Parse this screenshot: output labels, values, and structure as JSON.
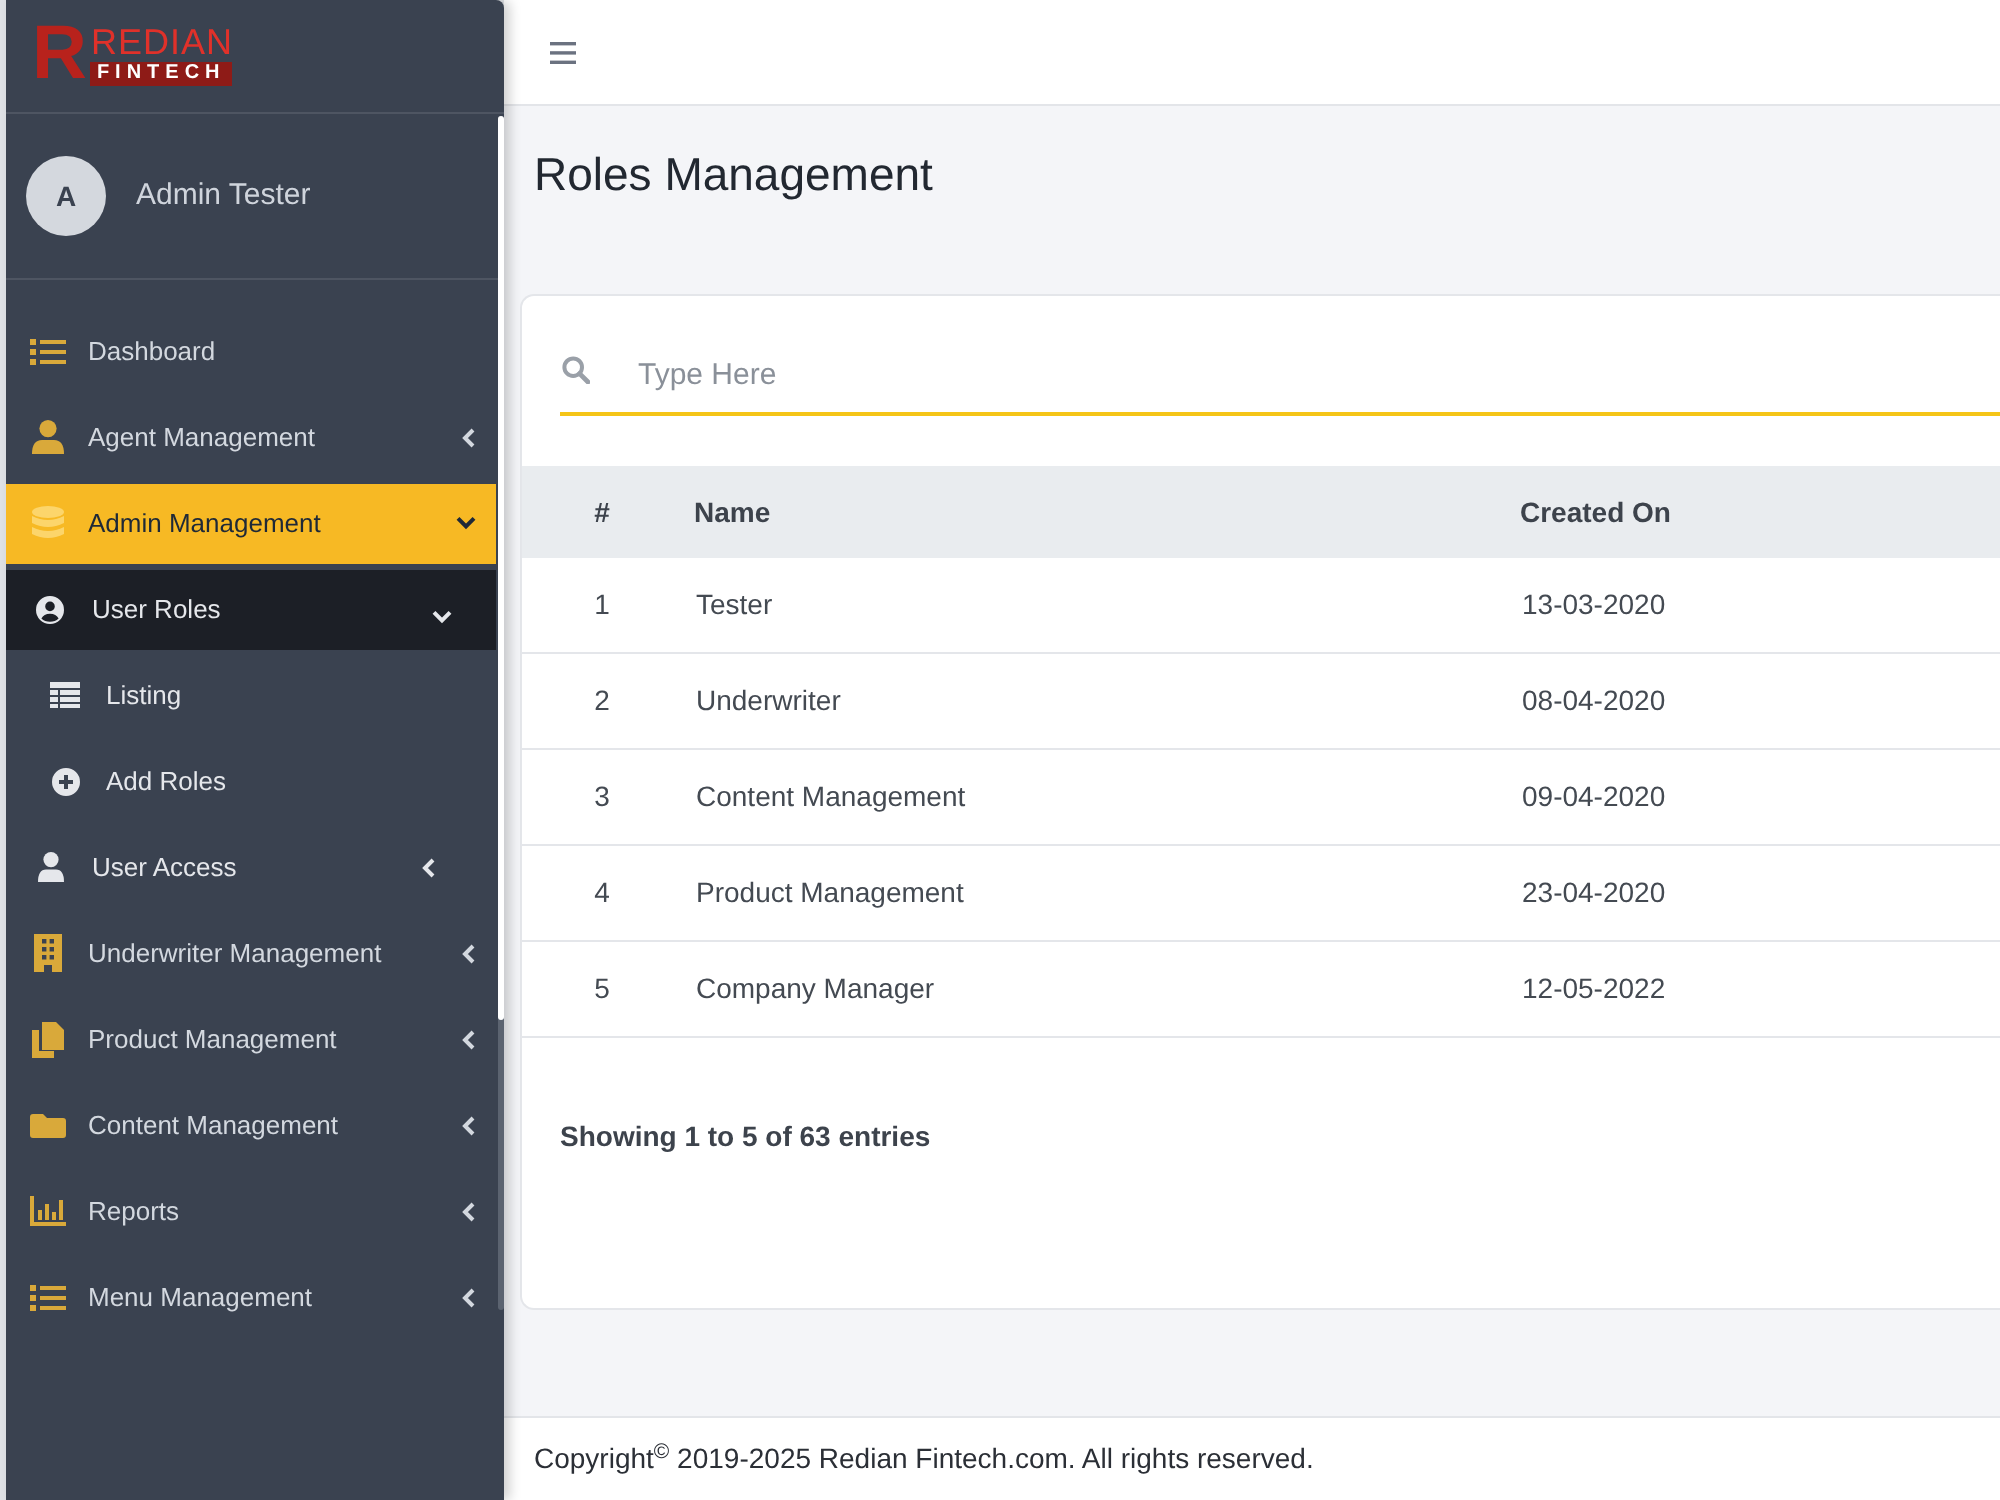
{
  "logo": {
    "mark": "R",
    "name": "REDIAN",
    "tagline": "FINTECH"
  },
  "user": {
    "initial": "A",
    "name": "Admin Tester"
  },
  "sidebar": {
    "items": [
      {
        "label": "Dashboard",
        "kind": "link",
        "selected": false
      },
      {
        "label": "Agent Management",
        "kind": "group",
        "selected": false,
        "expanded": false
      },
      {
        "label": "Admin Management",
        "kind": "group",
        "selected": true,
        "expanded": true,
        "children": [
          {
            "label": "User Roles",
            "kind": "group",
            "selected": true,
            "expanded": true,
            "children": [
              {
                "label": "Listing",
                "kind": "link",
                "selected": false
              },
              {
                "label": "Add Roles",
                "kind": "link",
                "selected": false
              }
            ]
          },
          {
            "label": "User Access",
            "kind": "group",
            "selected": false,
            "expanded": false
          }
        ]
      },
      {
        "label": "Underwriter Management",
        "kind": "group",
        "selected": false,
        "expanded": false
      },
      {
        "label": "Product Management",
        "kind": "group",
        "selected": false,
        "expanded": false
      },
      {
        "label": "Content Management",
        "kind": "group",
        "selected": false,
        "expanded": false
      },
      {
        "label": "Reports",
        "kind": "group",
        "selected": false,
        "expanded": false
      },
      {
        "label": "Menu Management",
        "kind": "group",
        "selected": false,
        "expanded": false
      }
    ]
  },
  "page": {
    "title": "Roles Management"
  },
  "search": {
    "placeholder": "Type Here"
  },
  "table": {
    "columns": [
      "#",
      "Name",
      "Created On"
    ],
    "rows": [
      [
        "1",
        "Tester",
        "13-03-2020"
      ],
      [
        "2",
        "Underwriter",
        "08-04-2020"
      ],
      [
        "3",
        "Content Management",
        "09-04-2020"
      ],
      [
        "4",
        "Product Management",
        "23-04-2020"
      ],
      [
        "5",
        "Company Manager",
        "12-05-2022"
      ]
    ]
  },
  "summary": "Showing 1 to 5 of 63 entries",
  "footer": "Copyright$^{©}$ 2019-2025 Redian Fintech.com. All rights reserved."
}
